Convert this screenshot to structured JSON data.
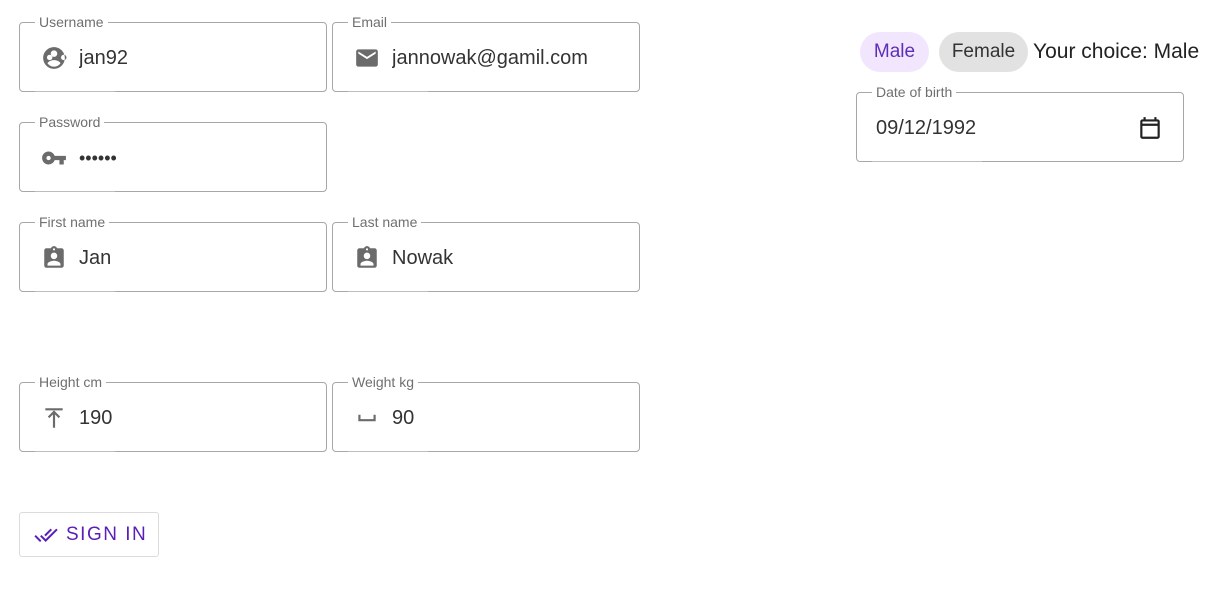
{
  "form": {
    "username": {
      "label": "Username",
      "value": "jan92",
      "icon": "face-icon"
    },
    "email": {
      "label": "Email",
      "value": "jannowak@gamil.com",
      "icon": "mail-icon"
    },
    "password": {
      "label": "Password",
      "value": "••••••",
      "icon": "key-icon"
    },
    "first_name": {
      "label": "First name",
      "value": "Jan",
      "icon": "contact-badge-icon"
    },
    "last_name": {
      "label": "Last name",
      "value": "Nowak",
      "icon": "contact-badge-icon"
    },
    "height": {
      "label": "Height cm",
      "value": "190",
      "icon": "vertical-height-icon"
    },
    "weight": {
      "label": "Weight kg",
      "value": "90",
      "icon": "space-bar-icon"
    },
    "date_of_birth": {
      "label": "Date of birth",
      "value": "09/12/1992",
      "icon": "calendar-icon"
    }
  },
  "gender": {
    "options": [
      "Male",
      "Female"
    ],
    "selected": "Male",
    "choice_text": "Your choice: Male"
  },
  "sign_in": {
    "label": "SIGN IN",
    "icon": "double-check-icon"
  },
  "colors": {
    "accent": "#5a1fb8",
    "chip_selected_bg": "#f1e6fd",
    "chip_unselected_bg": "#e2e2e2",
    "border": "#a7a7a7"
  }
}
